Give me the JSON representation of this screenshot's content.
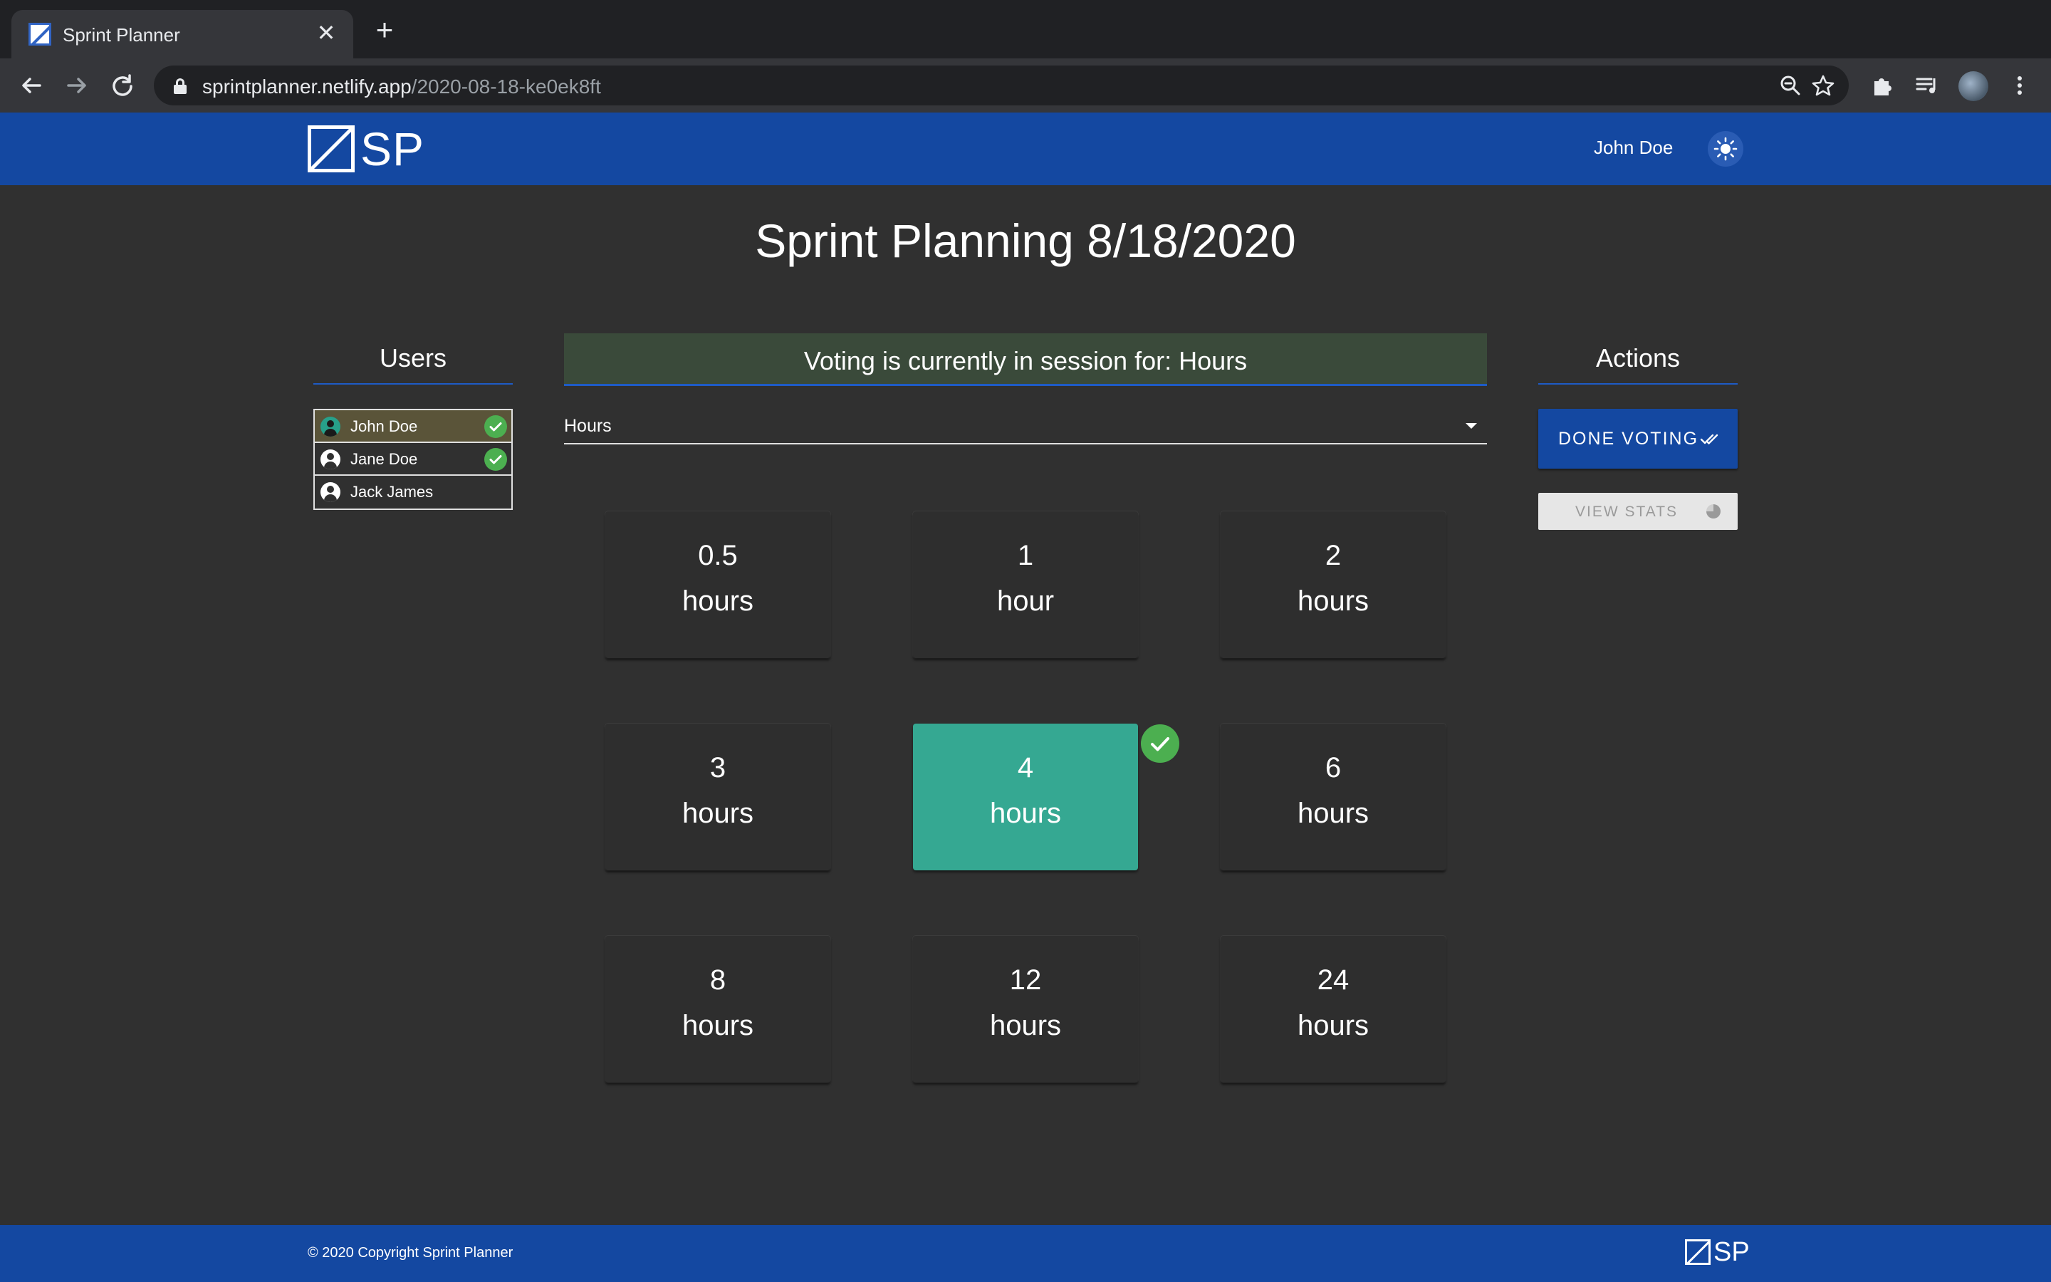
{
  "browser": {
    "tab_title": "Sprint Planner",
    "tab_close": "✕",
    "new_tab": "+",
    "url_host": "sprintplanner.netlify.app",
    "url_path": "/2020-08-18-ke0ek8ft",
    "icons": [
      "back-arrow-icon",
      "forward-arrow-icon",
      "reload-icon",
      "lock-icon",
      "zoom-icon",
      "star-icon",
      "extensions-icon",
      "media-icon",
      "profile-avatar",
      "menu-icon"
    ]
  },
  "header": {
    "logo_text": "SP",
    "user_name": "John Doe",
    "theme_icon": "sun-icon"
  },
  "page": {
    "title": "Sprint Planning 8/18/2020"
  },
  "users": {
    "heading": "Users",
    "items": [
      {
        "name": "John Doe",
        "voted": true,
        "current": true
      },
      {
        "name": "Jane Doe",
        "voted": true,
        "current": false
      },
      {
        "name": "Jack James",
        "voted": false,
        "current": false
      }
    ]
  },
  "session": {
    "banner": "Voting is currently in session for: Hours",
    "select_value": "Hours"
  },
  "cards": [
    {
      "value": "0.5",
      "unit": "hours",
      "selected": false
    },
    {
      "value": "1",
      "unit": "hour",
      "selected": false
    },
    {
      "value": "2",
      "unit": "hours",
      "selected": false
    },
    {
      "value": "3",
      "unit": "hours",
      "selected": false
    },
    {
      "value": "4",
      "unit": "hours",
      "selected": true
    },
    {
      "value": "6",
      "unit": "hours",
      "selected": false
    },
    {
      "value": "8",
      "unit": "hours",
      "selected": false
    },
    {
      "value": "12",
      "unit": "hours",
      "selected": false
    },
    {
      "value": "24",
      "unit": "hours",
      "selected": false
    }
  ],
  "actions": {
    "heading": "Actions",
    "done_label": "DONE VOTING",
    "stats_label": "VIEW STATS"
  },
  "footer": {
    "copyright": "© 2020 Copyright Sprint Planner",
    "logo_text": "SP"
  },
  "colors": {
    "brand_blue": "#1448a1",
    "selected_card": "#35a892",
    "check_green": "#4caf50",
    "background": "#303030"
  }
}
